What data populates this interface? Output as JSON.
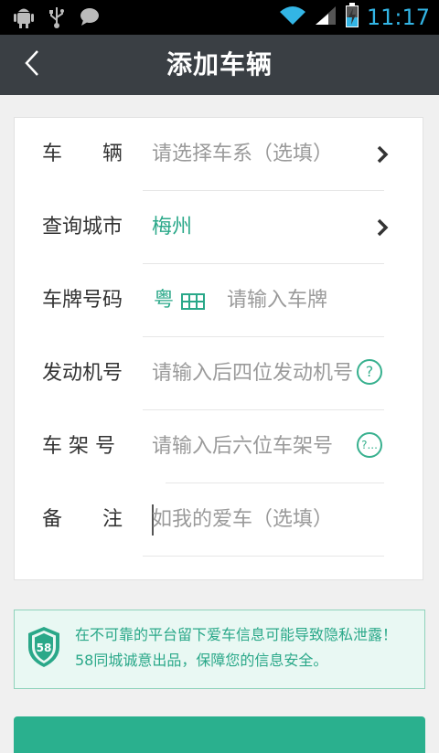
{
  "status_bar": {
    "time": "11:17",
    "icons": [
      "android-debug-icon",
      "usb-icon",
      "chat-bubble-icon",
      "wifi-icon",
      "signal-icon",
      "battery-charging-icon"
    ]
  },
  "header": {
    "title": "添加车辆",
    "back_icon": "chevron-left-icon"
  },
  "form": {
    "vehicle": {
      "label": "车　　辆",
      "placeholder": "请选择车系（选填）"
    },
    "city": {
      "label": "查询城市",
      "value": "梅州"
    },
    "plate": {
      "label": "车牌号码",
      "province": "粤",
      "placeholder": "请输入车牌"
    },
    "engine": {
      "label": "发动机号",
      "placeholder": "请输入后四位发动机号",
      "help": "?"
    },
    "frame": {
      "label": "车 架 号",
      "placeholder": "请输入后六位车架号",
      "help": "?..."
    },
    "remark": {
      "label": "备　　注",
      "placeholder": "如我的爱车（选填）"
    }
  },
  "notice": {
    "badge": "58",
    "text": "在不可靠的平台留下爱车信息可能导致隐私泄露！58同城诚意出品，保障您的信息安全。"
  },
  "colors": {
    "accent": "#2aa889",
    "titlebar": "#3a3f44",
    "notice_bg": "#e9f8f3"
  }
}
